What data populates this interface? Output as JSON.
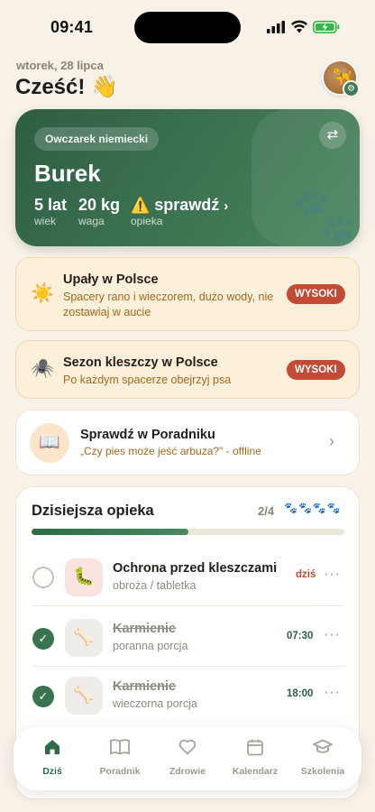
{
  "status": {
    "time": "09:41"
  },
  "header": {
    "date": "wtorek, 28 lipca",
    "greeting": "Cześć! 👋"
  },
  "pet": {
    "breed": "Owczarek niemiecki",
    "name": "Burek",
    "age_value": "5 lat",
    "age_label": "wiek",
    "weight_value": "20 kg",
    "weight_label": "waga",
    "care_value": "sprawdź",
    "care_label": "opieka"
  },
  "alerts": [
    {
      "icon": "sun-icon",
      "glyph": "☀️",
      "title": "Upały w Polsce",
      "text": "Spacery rano i wieczorem, dużo wody, nie zostawiaj w aucie",
      "badge": "WYSOKI",
      "badge_color": "#c44a36"
    },
    {
      "icon": "spider-icon",
      "glyph": "🕷️",
      "title": "Sezon kleszczy w Polsce",
      "text": "Po każdym spacerze obejrzyj psa",
      "badge": "WYSOKI",
      "badge_color": "#c44a36"
    }
  ],
  "guide": {
    "glyph": "📖",
    "title": "Sprawdź w Poradniku",
    "subtitle": "„Czy pies może jeść arbuza?\" - offline"
  },
  "care": {
    "title": "Dzisiejsza opieka",
    "count": "2/4",
    "progress": 0.5,
    "done": 2,
    "total": 4,
    "tasks": [
      {
        "title": "Ochrona przed kleszczami",
        "subtitle": "obroża / tabletka",
        "time": "dziś",
        "done": false,
        "icon": "tick-icon"
      },
      {
        "title": "Karmienie",
        "subtitle": "poranna porcja",
        "time": "07:30",
        "done": true,
        "icon": "bone-icon"
      },
      {
        "title": "Karmienie",
        "subtitle": "wieczorna porcja",
        "time": "18:00",
        "done": true,
        "icon": "bone-icon"
      }
    ]
  },
  "tabs": [
    {
      "label": "Dziś",
      "icon": "home-icon",
      "active": true
    },
    {
      "label": "Poradnik",
      "icon": "book-icon",
      "active": false
    },
    {
      "label": "Zdrowie",
      "icon": "heart-icon",
      "active": false
    },
    {
      "label": "Kalendarz",
      "icon": "calendar-icon",
      "active": false
    },
    {
      "label": "Szkolenia",
      "icon": "graduation-cap-icon",
      "active": false
    }
  ],
  "colors": {
    "accent": "#2e6b47",
    "alert_bg": "#fdf0da",
    "badge": "#c44a36",
    "background": "#f7f1e8"
  }
}
